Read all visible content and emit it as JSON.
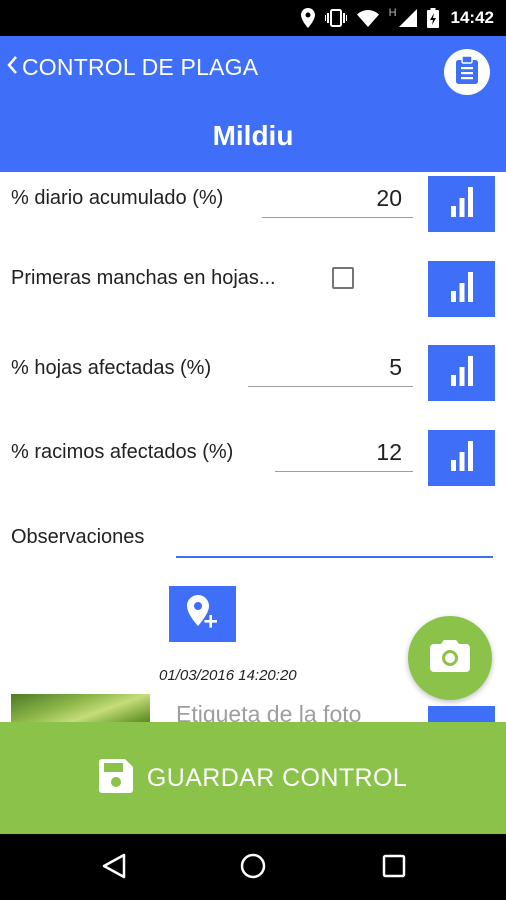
{
  "status_bar": {
    "time": "14:42",
    "network_letter": "H",
    "icons": [
      "location-icon",
      "vibrate-icon",
      "wifi-icon",
      "signal-icon",
      "battery-icon"
    ]
  },
  "app_bar": {
    "back_label": "CONTROL DE PLAGA",
    "title": "Mildiu",
    "color": "#3f6ef8",
    "action_icon": "clipboard-icon"
  },
  "form": {
    "fields": [
      {
        "label": "% diario acumulado (%)",
        "value": "20",
        "action_icon": "bar-chart-icon"
      },
      {
        "label": "Primeras manchas en hojas...",
        "checked": false,
        "action_icon": "bar-chart-icon"
      },
      {
        "label": "% hojas afectadas (%)",
        "value": "5",
        "action_icon": "bar-chart-icon"
      },
      {
        "label": "% racimos afectados (%)",
        "value": "12",
        "action_icon": "bar-chart-icon"
      }
    ],
    "observations": {
      "label": "Observaciones",
      "value": ""
    },
    "location_icon": "add-location-icon",
    "photo": {
      "date": "01/03/2016 14:20:20",
      "label_placeholder": "Etiqueta de la foto"
    }
  },
  "camera_fab": {
    "icon": "camera-icon",
    "color": "#8bc34a"
  },
  "save_button": {
    "label": "GUARDAR CONTROL",
    "icon": "save-icon",
    "color": "#8bc34a"
  },
  "nav_bar": {
    "icons": [
      "back-triangle-icon",
      "home-circle-icon",
      "recents-square-icon"
    ]
  }
}
